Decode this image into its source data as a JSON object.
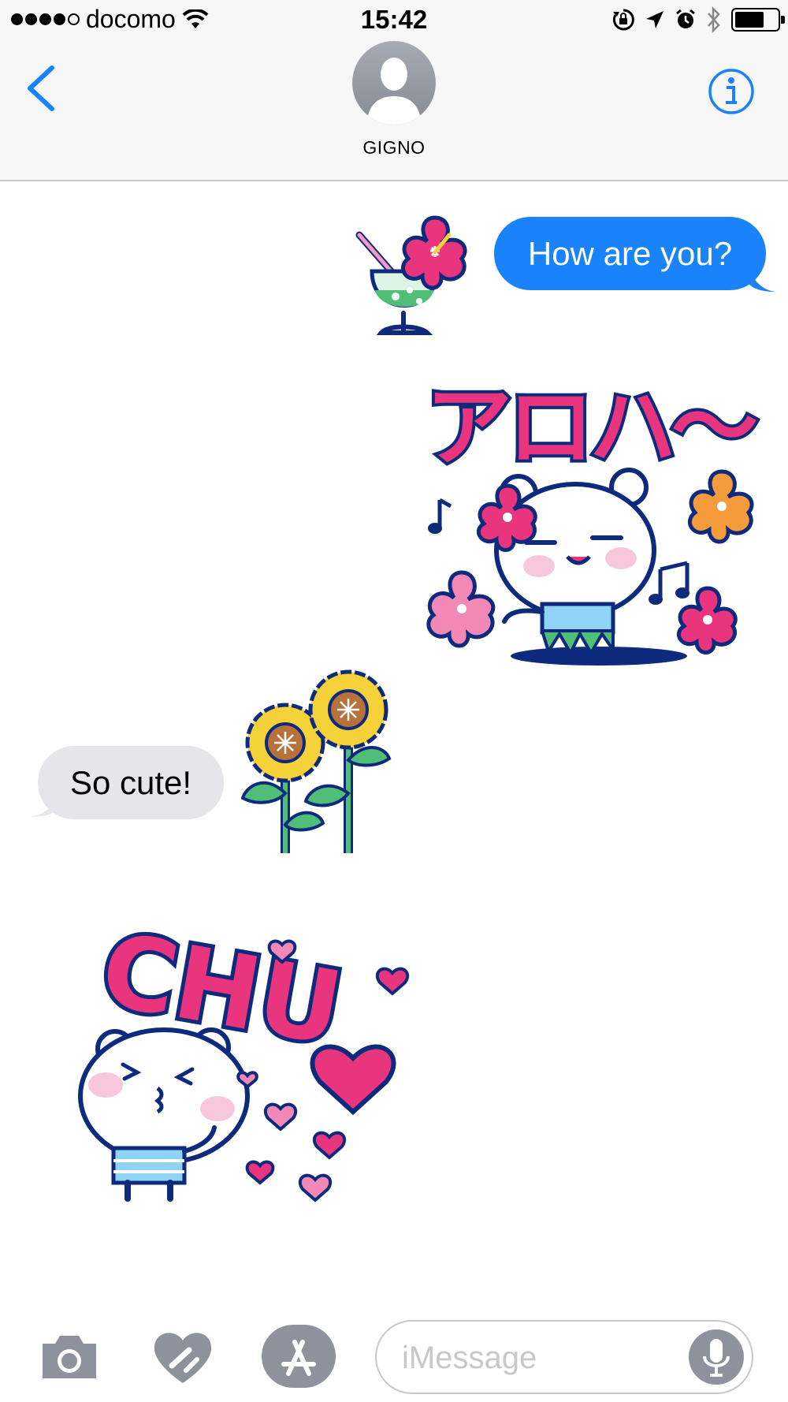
{
  "status_bar": {
    "carrier": "docomo",
    "time": "15:42",
    "signal_bars": 4,
    "battery_percent": 70
  },
  "nav": {
    "contact_name": "GIGNO"
  },
  "messages": [
    {
      "direction": "out",
      "text": "How are you?"
    },
    {
      "direction": "in",
      "text": "So cute!"
    }
  ],
  "stickers": [
    {
      "name": "tropical-drink-sticker"
    },
    {
      "name": "aloha-bear-sticker",
      "text": "アロハ〜"
    },
    {
      "name": "sunflowers-sticker"
    },
    {
      "name": "chu-bear-sticker",
      "text": "CHU"
    }
  ],
  "input_bar": {
    "placeholder": "iMessage"
  },
  "colors": {
    "ios_blue": "#1a82fb",
    "incoming_bubble": "#e6e6ea",
    "bar_background": "#f7f7f7",
    "icon_gray": "#8e929c",
    "sticker_pink": "#e8357e",
    "sticker_navy": "#0e2a7c"
  }
}
